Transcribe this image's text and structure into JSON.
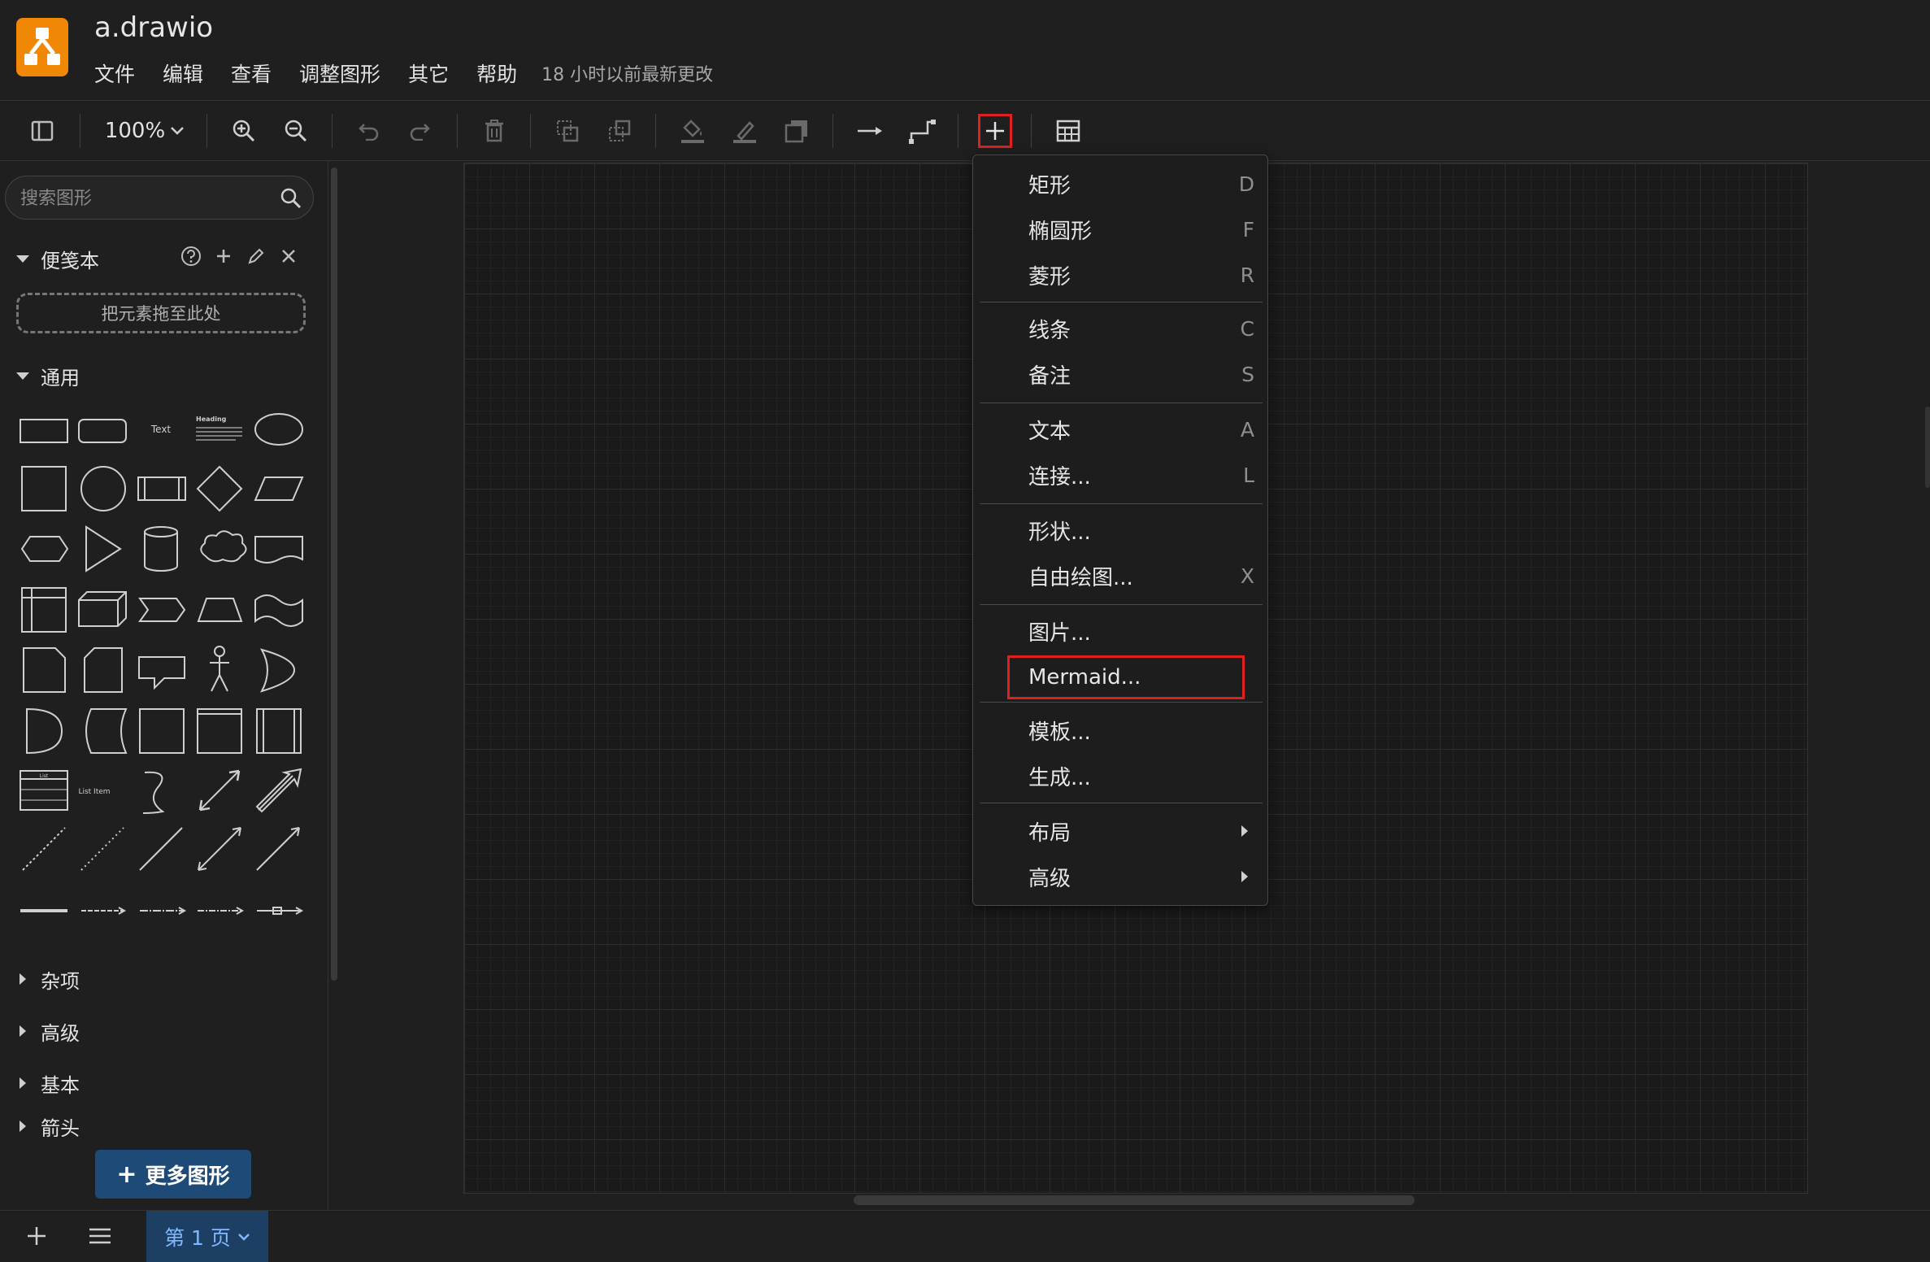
{
  "app": {
    "title": "a.drawio",
    "menu": [
      "文件",
      "编辑",
      "查看",
      "调整图形",
      "其它",
      "帮助"
    ],
    "last_change": "18 小时以前最新更改"
  },
  "toolbar": {
    "zoom": "100%",
    "icons": [
      "sidebar-toggle-icon",
      "zoom-in-icon",
      "zoom-out-icon",
      "undo-icon",
      "redo-icon",
      "delete-icon",
      "to-front-icon",
      "to-back-icon",
      "fill-color-icon",
      "line-color-icon",
      "shadow-icon",
      "connection-icon",
      "waypoints-icon",
      "insert-plus-icon",
      "table-icon"
    ]
  },
  "sidebar": {
    "search_placeholder": "搜索图形",
    "scratchpad": {
      "label": "便笺本",
      "dropzone": "把元素拖至此处"
    },
    "general": {
      "label": "通用"
    },
    "shape_texts": {
      "text": "Text",
      "heading": "Heading",
      "list_item": "List Item",
      "list": "List"
    },
    "collapsed_sections": [
      "杂项",
      "高级",
      "基本",
      "箭头"
    ],
    "more_shapes": "更多图形",
    "more_shapes_plus": "+"
  },
  "footer": {
    "page_tab": "第 1 页"
  },
  "insert_menu": {
    "items": [
      {
        "label": "矩形",
        "key": "D"
      },
      {
        "label": "椭圆形",
        "key": "F"
      },
      {
        "label": "菱形",
        "key": "R"
      },
      {
        "label": "线条",
        "key": "C"
      },
      {
        "label": "备注",
        "key": "S"
      },
      {
        "label": "文本",
        "key": "A"
      },
      {
        "label": "连接...",
        "key": "L"
      },
      {
        "label": "形状...",
        "key": ""
      },
      {
        "label": "自由绘图...",
        "key": "X"
      },
      {
        "label": "图片...",
        "key": ""
      },
      {
        "label": "Mermaid...",
        "key": ""
      },
      {
        "label": "模板...",
        "key": ""
      },
      {
        "label": "生成...",
        "key": ""
      },
      {
        "label": "布局",
        "key": ""
      },
      {
        "label": "高级",
        "key": ""
      }
    ],
    "highlighted": "Mermaid..."
  },
  "colors": {
    "accent_highlight": "#e01f1f",
    "logo": "#f08705",
    "page_tab_bg": "#1e3f64",
    "more_shapes_bg": "#1e4a78"
  }
}
